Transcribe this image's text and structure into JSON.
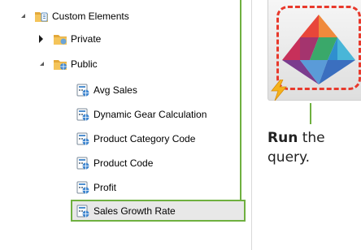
{
  "tree": {
    "root": {
      "label": "Custom Elements",
      "icon": "folder-info-icon",
      "expanded": true
    },
    "private": {
      "label": "Private",
      "icon": "folder-icon",
      "expanded": false
    },
    "public": {
      "label": "Public",
      "icon": "folder-globe-icon",
      "expanded": true
    },
    "items": [
      {
        "label": "Avg Sales",
        "icon": "calculation-icon"
      },
      {
        "label": "Dynamic Gear Calculation",
        "icon": "calculation-icon"
      },
      {
        "label": "Product Category Code",
        "icon": "calculation-icon"
      },
      {
        "label": "Product Code",
        "icon": "calculation-icon"
      },
      {
        "label": "Profit",
        "icon": "calculation-icon"
      },
      {
        "label": "Sales Growth Rate",
        "icon": "calculation-icon",
        "selected": true
      }
    ]
  },
  "run_button": {
    "icon": "run-query-icon"
  },
  "instruction": {
    "bold": "Run",
    "rest_line1": " the",
    "line2": "query."
  },
  "colors": {
    "accent_green": "#6fb040",
    "dash_red": "#e8392c",
    "bolt_yellow": "#f5b21b"
  }
}
